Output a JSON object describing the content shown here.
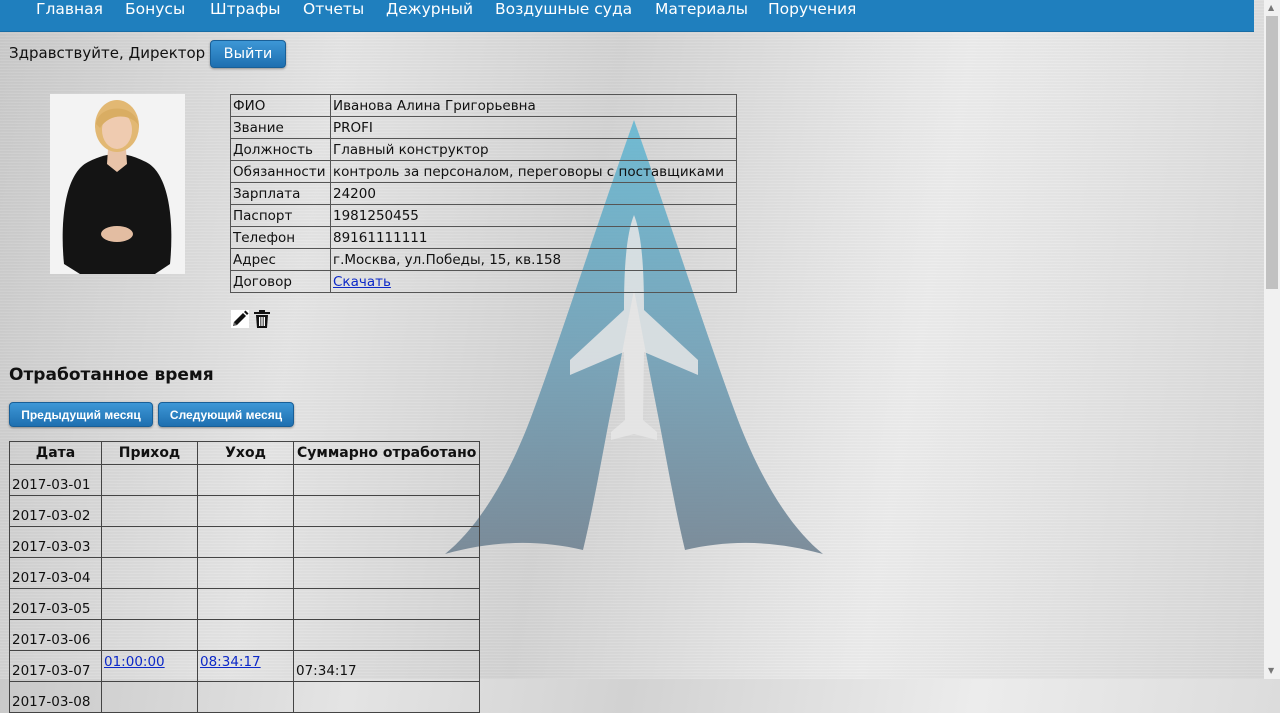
{
  "nav": {
    "items": [
      "Главная",
      "Бонусы",
      "Штрафы",
      "Отчеты",
      "Дежурный",
      "Воздушные суда",
      "Материалы",
      "Поручения"
    ]
  },
  "header": {
    "greeting": "Здравствуйте, Директор",
    "logout_label": "Выйти"
  },
  "profile": {
    "photo_icon": "employee-photo",
    "rows": [
      {
        "label": "ФИО",
        "value": "Иванова Алина Григорьевна"
      },
      {
        "label": "Звание",
        "value": "PROFI"
      },
      {
        "label": "Должность",
        "value": "Главный конструктор"
      },
      {
        "label": "Обязанности",
        "value": "контроль за персоналом, переговоры с поставщиками"
      },
      {
        "label": "Зарплата",
        "value": "24200"
      },
      {
        "label": "Паспорт",
        "value": "1981250455"
      },
      {
        "label": "Телефон",
        "value": "89161111111"
      },
      {
        "label": "Адрес",
        "value": "г.Москва, ул.Победы, 15, кв.158"
      }
    ],
    "contract": {
      "label": "Договор",
      "link_text": "Скачать"
    },
    "actions": [
      "pencil-icon",
      "trash-icon"
    ]
  },
  "worktime": {
    "title": "Отработанное время",
    "prev_label": "Предыдущий месяц",
    "next_label": "Следующий месяц",
    "headers": [
      "Дата",
      "Приход",
      "Уход",
      "Суммарно отработано"
    ],
    "rows": [
      {
        "date": "2017-03-01",
        "in": "",
        "out": "",
        "total": ""
      },
      {
        "date": "2017-03-02",
        "in": "",
        "out": "",
        "total": ""
      },
      {
        "date": "2017-03-03",
        "in": "",
        "out": "",
        "total": ""
      },
      {
        "date": "2017-03-04",
        "in": "",
        "out": "",
        "total": ""
      },
      {
        "date": "2017-03-05",
        "in": "",
        "out": "",
        "total": ""
      },
      {
        "date": "2017-03-06",
        "in": "",
        "out": "",
        "total": ""
      },
      {
        "date": "2017-03-07",
        "in": "01:00:00",
        "out": "08:34:17",
        "total": "07:34:17"
      },
      {
        "date": "2017-03-08",
        "in": "",
        "out": "",
        "total": ""
      }
    ]
  },
  "colors": {
    "nav_bg": "#1f7fbe",
    "button_blue": "#2a82c4",
    "link": "#0d29c8",
    "logo_teal": "#5fb3cd",
    "logo_slate": "#6b7e8e"
  }
}
